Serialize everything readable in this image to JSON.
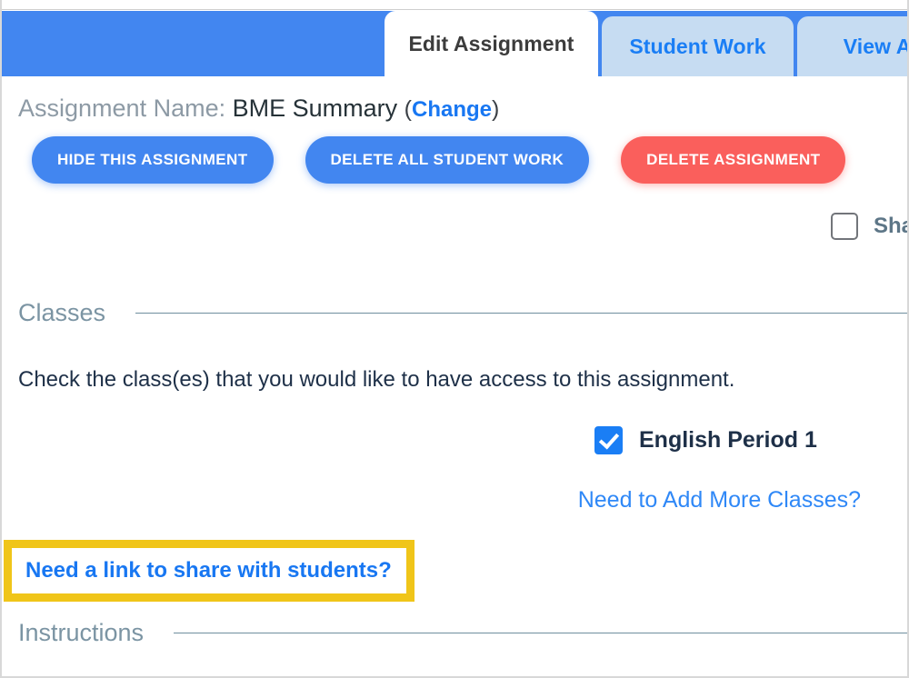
{
  "tabs": [
    {
      "label": "Edit Assignment",
      "state": "active"
    },
    {
      "label": "Student Work",
      "state": "inactive"
    },
    {
      "label": "View As S",
      "state": "inactive"
    }
  ],
  "assignment": {
    "name_label": "Assignment Name:",
    "name_value": "BME Summary",
    "paren_open": "(",
    "change_link": "Change",
    "paren_close": ")"
  },
  "actions": {
    "hide_label": "HIDE THIS ASSIGNMENT",
    "delete_work_label": "DELETE ALL STUDENT WORK",
    "delete_assignment_label": "DELETE ASSIGNMENT"
  },
  "share_option": {
    "label": "Sha",
    "checked": false
  },
  "classes_section": {
    "title": "Classes",
    "instruction": "Check the class(es) that you would like to have access to this assignment.",
    "items": [
      {
        "label": "English Period 1",
        "checked": true
      }
    ],
    "add_classes_link": "Need to Add More Classes?",
    "share_link": "Need a link to share with students?"
  },
  "instructions_section": {
    "title": "Instructions"
  },
  "colors": {
    "brand_blue": "#4286f0",
    "tab_inactive_blue": "#c6dcf2",
    "link_blue": "#1877f2",
    "checkbox_blue": "#1a7ef5",
    "danger_red": "#fa5f5c",
    "section_gray": "#7b94a3",
    "highlight_yellow": "#f0c519",
    "text_navy": "#1e3048"
  }
}
